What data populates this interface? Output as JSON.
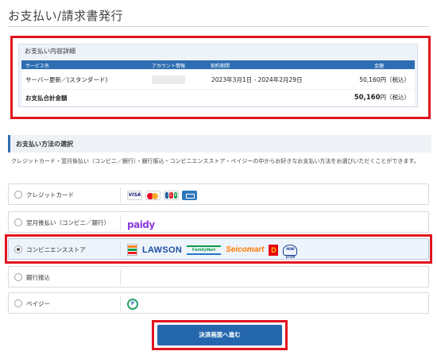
{
  "page": {
    "title": "お支払い/請求書発行"
  },
  "details": {
    "title": "お支払い内容詳細",
    "columns": [
      "サービス名",
      "アカウント情報",
      "契約期間",
      "金額"
    ],
    "row": {
      "service": "サーバー更新／(スタンダード)",
      "account": "",
      "period": "2023年3月1日 - 2024年2月29日",
      "amount": "50,160円（税込）"
    },
    "total": {
      "label": "お支払合計金額",
      "amount": "50,160",
      "suffix": "円（税込）"
    }
  },
  "method_section": {
    "title": "お支払い方法の選択",
    "description": "クレジットカード・翌月後払い（コンビニ／銀行）・銀行振込・コンビニエンスストア・ペイジーの中からお好きなお支払い方法をお選びいただくことができます。"
  },
  "options": [
    {
      "label": "クレジットカード",
      "selected": false,
      "logos": [
        "VISA",
        "Mastercard",
        "JCB",
        "AMEX"
      ]
    },
    {
      "label": "翌月後払い（コンビニ／銀行）",
      "selected": false,
      "logos": [
        "paidy"
      ]
    },
    {
      "label": "コンビニエンスストア",
      "selected": true,
      "logos": [
        "7-Eleven",
        "LAWSON",
        "FamilyMart",
        "Seicomart",
        "Daily Yamazaki",
        "Ministop"
      ]
    },
    {
      "label": "銀行振込",
      "selected": false,
      "logos": []
    },
    {
      "label": "ペイジー",
      "selected": false,
      "logos": [
        "Pay-easy"
      ]
    }
  ],
  "logo_text": {
    "visa": "VISA",
    "jcb": [
      "J",
      "C",
      "B"
    ],
    "paidy": "paidy",
    "lawson": "LAWSON",
    "familymart": "FamilyMart",
    "seicomart": "Seicomart",
    "daily": "D",
    "ministop": "MINI STOP",
    "payeasy": "P"
  },
  "submit": {
    "label": "決済画面へ進む"
  },
  "colors": {
    "accent": "#2567ad",
    "highlight": "#e1141e",
    "panel": "#eef3f9"
  }
}
